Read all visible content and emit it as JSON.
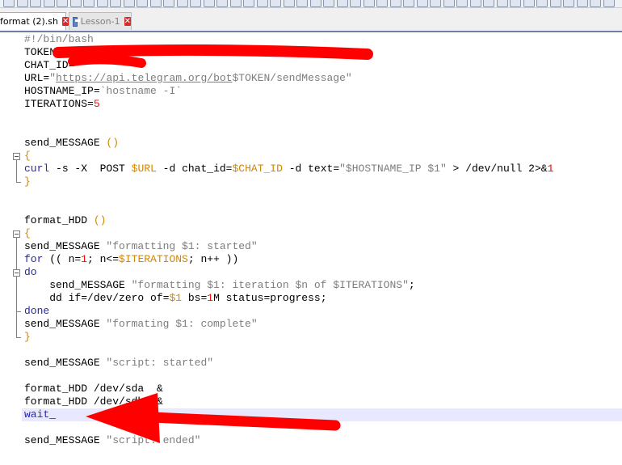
{
  "tabs": [
    {
      "label": "format (2).sh",
      "active": true
    },
    {
      "label": "Lesson-1",
      "active": false
    }
  ],
  "code_lines": [
    {
      "n": 0,
      "segs": [
        [
          "str",
          "#!/bin/bash"
        ]
      ]
    },
    {
      "n": 1,
      "segs": [
        [
          "op",
          "TOKEN="
        ]
      ]
    },
    {
      "n": 2,
      "segs": [
        [
          "op",
          "CHAT_ID="
        ]
      ]
    },
    {
      "n": 3,
      "segs": [
        [
          "op",
          "URL="
        ],
        [
          "str",
          "\""
        ],
        [
          "url",
          "https://api.telegram.org/bot"
        ],
        [
          "str",
          "$TOKEN/sendMessage\""
        ]
      ]
    },
    {
      "n": 4,
      "segs": [
        [
          "op",
          "HOSTNAME_IP="
        ],
        [
          "str",
          "`hostname -I`"
        ]
      ]
    },
    {
      "n": 5,
      "segs": [
        [
          "op",
          "ITERATIONS="
        ],
        [
          "num",
          "5"
        ]
      ]
    },
    {
      "n": 8,
      "segs": [
        [
          "op",
          "send_MESSAGE "
        ],
        [
          "var",
          "()"
        ]
      ]
    },
    {
      "n": 9,
      "segs": [
        [
          "var",
          "{"
        ]
      ]
    },
    {
      "n": 10,
      "segs": [
        [
          "kw",
          "curl"
        ],
        [
          "op",
          " -s -X  POST "
        ],
        [
          "var",
          "$URL"
        ],
        [
          "op",
          " -d chat_id="
        ],
        [
          "var",
          "$CHAT_ID"
        ],
        [
          "op",
          " -d text="
        ],
        [
          "str",
          "\"$HOSTNAME_IP $1\""
        ],
        [
          "op",
          " > /dev/null 2>&"
        ],
        [
          "num",
          "1"
        ]
      ]
    },
    {
      "n": 11,
      "segs": [
        [
          "var",
          "}"
        ]
      ]
    },
    {
      "n": 14,
      "segs": [
        [
          "op",
          "format_HDD "
        ],
        [
          "var",
          "()"
        ]
      ]
    },
    {
      "n": 15,
      "segs": [
        [
          "var",
          "{"
        ]
      ]
    },
    {
      "n": 16,
      "segs": [
        [
          "op",
          "send_MESSAGE "
        ],
        [
          "str",
          "\"formatting $1: started\""
        ]
      ]
    },
    {
      "n": 17,
      "segs": [
        [
          "kw",
          "for"
        ],
        [
          "op",
          " (( n="
        ],
        [
          "num",
          "1"
        ],
        [
          "op",
          "; n<="
        ],
        [
          "var",
          "$ITERATIONS"
        ],
        [
          "op",
          "; n++ ))"
        ]
      ]
    },
    {
      "n": 18,
      "segs": [
        [
          "kw",
          "do"
        ]
      ]
    },
    {
      "n": 19,
      "segs": [
        [
          "op",
          "    send_MESSAGE "
        ],
        [
          "str",
          "\"formatting $1: iteration $n of $ITERATIONS\""
        ],
        [
          "op",
          ";"
        ]
      ]
    },
    {
      "n": 20,
      "segs": [
        [
          "op",
          "    dd if=/dev/zero of="
        ],
        [
          "var",
          "$1"
        ],
        [
          "op",
          " bs="
        ],
        [
          "num",
          "1"
        ],
        [
          "op",
          "M status=progress;"
        ]
      ]
    },
    {
      "n": 21,
      "segs": [
        [
          "kw",
          "done"
        ]
      ]
    },
    {
      "n": 22,
      "segs": [
        [
          "op",
          "send_MESSAGE "
        ],
        [
          "str",
          "\"formating $1: complete\""
        ]
      ]
    },
    {
      "n": 23,
      "segs": [
        [
          "var",
          "}"
        ]
      ]
    },
    {
      "n": 25,
      "segs": [
        [
          "op",
          "send_MESSAGE "
        ],
        [
          "str",
          "\"script: started\""
        ]
      ]
    },
    {
      "n": 27,
      "segs": [
        [
          "op",
          "format_HDD /dev/sda  &"
        ]
      ]
    },
    {
      "n": 28,
      "segs": [
        [
          "op",
          "format_HDD /dev/sdb  &"
        ]
      ]
    },
    {
      "n": 29,
      "segs": [
        [
          "kw",
          "wait"
        ],
        [
          "op",
          "_"
        ]
      ]
    },
    {
      "n": 31,
      "segs": [
        [
          "op",
          "send_MESSAGE "
        ],
        [
          "str",
          "\"script: ended\""
        ]
      ]
    }
  ],
  "colors": {
    "keyword": "#2424c7",
    "string": "#7d7d7d",
    "number": "#ff0000",
    "variable": "#d28600",
    "annotation": "#ff0000"
  }
}
